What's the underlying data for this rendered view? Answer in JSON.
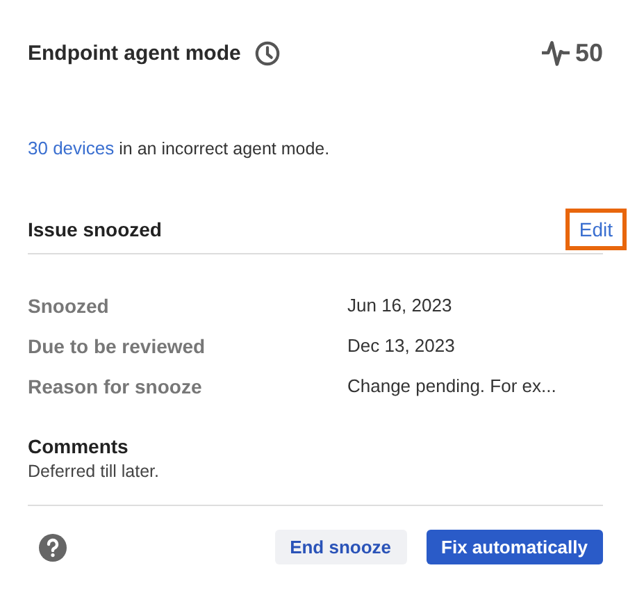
{
  "header": {
    "title": "Endpoint agent mode",
    "score": "50"
  },
  "summary": {
    "link": "30 devices",
    "text": " in an incorrect agent mode."
  },
  "section": {
    "title": "Issue snoozed",
    "edit": {
      "label": "Edit",
      "highlighted": true
    }
  },
  "details": [
    {
      "label": "Snoozed",
      "value": "Jun 16, 2023"
    },
    {
      "label": "Due to be reviewed",
      "value": "Dec 13, 2023"
    },
    {
      "label": "Reason for snooze",
      "value": "Change pending. For ex..."
    }
  ],
  "comments": {
    "title": "Comments",
    "text": "Deferred till later."
  },
  "buttons": [
    {
      "label": "End snooze",
      "kind": "secondary"
    },
    {
      "label": "Fix automatically",
      "kind": "primary"
    }
  ]
}
